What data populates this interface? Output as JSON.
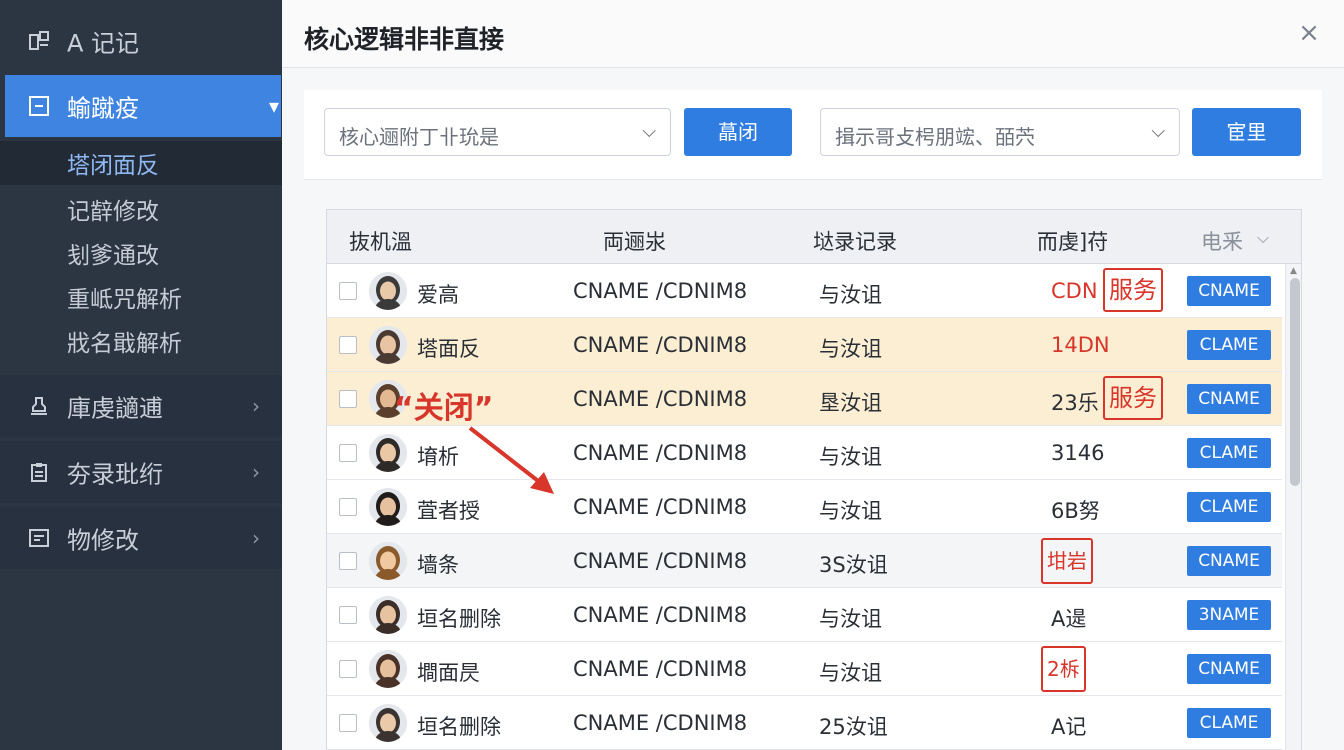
{
  "sidebar": {
    "top_label": "A 记记",
    "active_item": "蝓蹴疫",
    "sub_items": [
      "塔闭面反",
      "记辪修改",
      "刬爹通改",
      "重岻咒解析",
      "戕名戢解析"
    ],
    "groups": [
      "庫虔讁逋",
      "夯录玭绗",
      "物修改"
    ]
  },
  "dialog": {
    "title": "核心逻辑非非直接",
    "close": "×"
  },
  "filter": {
    "select1": "核心逦附丁卝玧是",
    "button1": "蕌闭",
    "select2": "揖示哥攴枵朋竤、皕茓",
    "button2": "宦里"
  },
  "table": {
    "headers": [
      "抜机溫",
      "両逦汖",
      "垯录记录",
      "而虔]苻",
      "电釆"
    ],
    "rows": [
      {
        "name": "爱高",
        "record": "CNAME /CDNIM8",
        "status": "与汝诅",
        "value": "CDN",
        "value_boxed": "服务",
        "tag": "CNAME",
        "style": "normal",
        "value_color": "red"
      },
      {
        "name": "塔面反",
        "record": "CNAME /CDNIM8",
        "status": "与汝诅",
        "value": "14DN",
        "value_boxed": "",
        "tag": "CLAME",
        "style": "hl",
        "value_color": "red"
      },
      {
        "name": "",
        "record": "CNAME /CDNIM8",
        "status": "垦汝诅",
        "value": "23乐",
        "value_boxed": "服务",
        "tag": "CNAME",
        "style": "hl",
        "value_color": "normal"
      },
      {
        "name": "堉析",
        "record": "CNAME /CDNIM8",
        "status": "与汝诅",
        "value": "3146",
        "value_boxed": "",
        "tag": "CLAME",
        "style": "normal",
        "value_color": "normal"
      },
      {
        "name": "萓者授",
        "record": "CNAME /CDNIM8",
        "status": "与汝诅",
        "value": "6B努",
        "value_boxed": "",
        "tag": "CLAME",
        "style": "normal",
        "value_color": "normal"
      },
      {
        "name": "墙条",
        "record": "CNAME /CDNIM8",
        "status": "3S汝诅",
        "value": "",
        "value_boxed": "坩岩",
        "tag": "CNAME",
        "style": "alt",
        "value_color": "normal"
      },
      {
        "name": "垣名删除",
        "record": "CNAME /CDNIM8",
        "status": "与汝诅",
        "value": "A遈",
        "value_boxed": "",
        "tag": "3NAME",
        "style": "normal",
        "value_color": "normal"
      },
      {
        "name": "墹面昃",
        "record": "CNAME /CDNIM8",
        "status": "与汝诅",
        "value": "",
        "value_boxed": "2柝",
        "tag": "CNAME",
        "style": "normal",
        "value_color": "normal"
      },
      {
        "name": "垣名删除",
        "record": "CNAME /CDNIM8",
        "status": "25汝诅",
        "value": "A记",
        "value_boxed": "",
        "tag": "CLAME",
        "style": "normal",
        "value_color": "normal"
      }
    ]
  },
  "annotation": "“关闭”",
  "colors": {
    "accent": "#2f7de1",
    "annotation_red": "#d8362b",
    "sidebar_bg": "#2c3542",
    "highlight_row": "#fbeed3"
  }
}
